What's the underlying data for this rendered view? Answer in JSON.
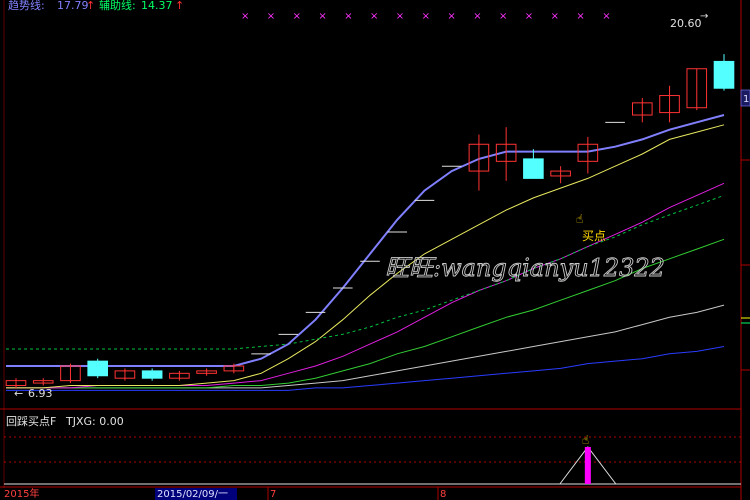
{
  "top_legend": {
    "trend_label": "趋势线:",
    "trend_value": "17.79",
    "trend_arrow": "↑",
    "aux_label": "辅助线:",
    "aux_value": "14.37",
    "aux_arrow": "↑"
  },
  "price_labels": {
    "high": "20.60",
    "low": "6.93"
  },
  "annotation": {
    "buy_point": "买点",
    "watermark": "旺旺:wangqianyu12322"
  },
  "indicator_panel": {
    "title": "回踩买点F",
    "value_label": "TJXG: 0.00"
  },
  "right_edge": {
    "marker": "1"
  },
  "date_axis": {
    "year": "2015年",
    "cursor_date": "2015/02/09/一",
    "month_1": "7",
    "month_2": "8"
  },
  "colors": {
    "trend_line": "#8080ff",
    "aux_line": "#00ff66",
    "up_candle": "#ff3333",
    "down_candle": "#54ffff",
    "indicator_bar": "#ff00ff",
    "axis_red": "#b00000"
  },
  "chart_data": {
    "type": "candlestick",
    "candles": [
      {
        "o": 7.0,
        "h": 7.3,
        "l": 6.9,
        "c": 7.2
      },
      {
        "o": 7.1,
        "h": 7.3,
        "l": 7.0,
        "c": 7.2
      },
      {
        "o": 7.2,
        "h": 7.9,
        "l": 7.1,
        "c": 7.8
      },
      {
        "o": 8.0,
        "h": 8.1,
        "l": 7.3,
        "c": 7.4
      },
      {
        "o": 7.3,
        "h": 7.7,
        "l": 7.2,
        "c": 7.6
      },
      {
        "o": 7.6,
        "h": 7.7,
        "l": 7.2,
        "c": 7.3
      },
      {
        "o": 7.3,
        "h": 7.6,
        "l": 7.2,
        "c": 7.5
      },
      {
        "o": 7.5,
        "h": 7.7,
        "l": 7.4,
        "c": 7.6
      },
      {
        "o": 7.6,
        "h": 7.9,
        "l": 7.5,
        "c": 7.8
      },
      {
        "o": 8.3,
        "h": 8.3,
        "l": 8.3,
        "c": 8.3
      },
      {
        "o": 9.1,
        "h": 9.1,
        "l": 9.1,
        "c": 9.1
      },
      {
        "o": 10.0,
        "h": 10.0,
        "l": 10.0,
        "c": 10.0
      },
      {
        "o": 11.0,
        "h": 11.0,
        "l": 11.0,
        "c": 11.0
      },
      {
        "o": 12.1,
        "h": 12.1,
        "l": 12.1,
        "c": 12.1
      },
      {
        "o": 13.3,
        "h": 13.3,
        "l": 13.3,
        "c": 13.3
      },
      {
        "o": 14.6,
        "h": 14.6,
        "l": 14.6,
        "c": 14.6
      },
      {
        "o": 16.0,
        "h": 16.0,
        "l": 16.0,
        "c": 16.0
      },
      {
        "o": 15.8,
        "h": 17.3,
        "l": 15.0,
        "c": 16.9
      },
      {
        "o": 16.2,
        "h": 17.6,
        "l": 15.4,
        "c": 16.9
      },
      {
        "o": 16.3,
        "h": 16.7,
        "l": 15.5,
        "c": 15.5
      },
      {
        "o": 15.6,
        "h": 16.0,
        "l": 15.3,
        "c": 15.8
      },
      {
        "o": 16.2,
        "h": 17.2,
        "l": 15.7,
        "c": 16.9
      },
      {
        "o": 17.8,
        "h": 17.8,
        "l": 17.8,
        "c": 17.8
      },
      {
        "o": 18.1,
        "h": 18.8,
        "l": 17.8,
        "c": 18.6
      },
      {
        "o": 18.2,
        "h": 19.3,
        "l": 17.8,
        "c": 18.9
      },
      {
        "o": 18.4,
        "h": 20.0,
        "l": 18.3,
        "c": 20.0
      },
      {
        "o": 20.3,
        "h": 20.6,
        "l": 19.1,
        "c": 19.2
      }
    ],
    "trend_line": [
      7.8,
      7.8,
      7.8,
      7.8,
      7.8,
      7.8,
      7.8,
      7.8,
      7.8,
      8.1,
      8.7,
      9.7,
      11.0,
      12.4,
      13.8,
      15.0,
      15.8,
      16.3,
      16.6,
      16.6,
      16.6,
      16.6,
      16.8,
      17.1,
      17.5,
      17.8,
      18.1
    ],
    "aux_dashed": [
      8.5,
      8.5,
      8.5,
      8.5,
      8.5,
      8.5,
      8.5,
      8.5,
      8.5,
      8.6,
      8.7,
      8.9,
      9.1,
      9.4,
      9.8,
      10.1,
      10.5,
      10.9,
      11.3,
      11.8,
      12.2,
      12.7,
      13.1,
      13.6,
      14.0,
      14.4,
      14.8
    ],
    "ma_yellow": [
      6.9,
      6.9,
      7.0,
      7.0,
      7.0,
      7.0,
      7.0,
      7.1,
      7.2,
      7.5,
      8.1,
      8.8,
      9.7,
      10.7,
      11.6,
      12.4,
      13.0,
      13.6,
      14.2,
      14.7,
      15.1,
      15.5,
      16.0,
      16.5,
      17.1,
      17.4,
      17.7
    ],
    "ma_magenta": [
      6.9,
      6.9,
      6.9,
      7.0,
      7.0,
      7.0,
      7.0,
      7.0,
      7.1,
      7.2,
      7.5,
      7.8,
      8.2,
      8.7,
      9.2,
      9.8,
      10.4,
      10.9,
      11.3,
      11.8,
      12.2,
      12.7,
      13.2,
      13.7,
      14.3,
      14.8,
      15.3
    ],
    "ma_green": [
      6.9,
      6.9,
      6.9,
      6.9,
      6.9,
      6.9,
      6.9,
      6.9,
      7.0,
      7.0,
      7.1,
      7.3,
      7.6,
      7.9,
      8.3,
      8.6,
      9.0,
      9.4,
      9.8,
      10.1,
      10.5,
      10.9,
      11.3,
      11.8,
      12.2,
      12.6,
      13.0
    ],
    "ma_white": [
      6.9,
      6.9,
      6.9,
      6.9,
      6.9,
      6.9,
      6.9,
      6.9,
      6.9,
      6.9,
      7.0,
      7.1,
      7.2,
      7.4,
      7.6,
      7.8,
      8.0,
      8.2,
      8.4,
      8.6,
      8.8,
      9.0,
      9.2,
      9.5,
      9.8,
      10.0,
      10.3
    ],
    "ma_blue": [
      6.8,
      6.8,
      6.8,
      6.8,
      6.8,
      6.8,
      6.8,
      6.8,
      6.8,
      6.8,
      6.8,
      6.9,
      6.9,
      7.0,
      7.1,
      7.2,
      7.3,
      7.4,
      7.5,
      7.6,
      7.7,
      7.9,
      8.0,
      8.1,
      8.3,
      8.4,
      8.6
    ],
    "indicator_signal_index": 21,
    "ylim": [
      6.2,
      22.0
    ]
  }
}
